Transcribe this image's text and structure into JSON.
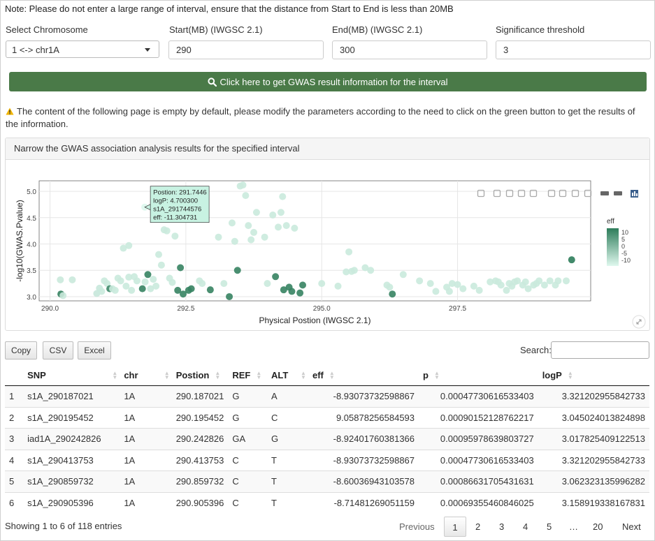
{
  "note": "Note: Please do not enter a large range of interval, ensure that the distance from Start to End is less than 20MB",
  "form": {
    "chromosome_label": "Select Chromosome",
    "chromosome_value": "1 <-> chr1A",
    "start_label": "Start(MB) (IWGSC 2.1)",
    "start_value": "290",
    "end_label": "End(MB) (IWGSC 2.1)",
    "end_value": "300",
    "threshold_label": "Significance threshold",
    "threshold_value": "3"
  },
  "button_label": "Click here to get GWAS result information for the interval",
  "warning": "The content of the following page is empty by default, please modify the parameters according to the need to click on the green button to get the results of the information.",
  "panel_title": "Narrow the GWAS association analysis results for the specified interval",
  "colors": {
    "accent": "#4a7a48",
    "low": "#dff8ee",
    "high": "#2e7d5b"
  },
  "chart_data": {
    "type": "scatter",
    "xlabel": "Physical Postion (IWGSC 2.1)",
    "ylabel": "-log10(GWAS.Pvalue)",
    "xlim": [
      289.8,
      299.95
    ],
    "ylim": [
      2.92,
      5.2
    ],
    "xticks": [
      290.0,
      292.5,
      295.0,
      297.5
    ],
    "xtick_labels": [
      "290.0",
      "292.5",
      "295.0",
      "297.5"
    ],
    "yticks": [
      3.0,
      3.5,
      4.0,
      4.5,
      5.0
    ],
    "ytick_labels": [
      "3.0",
      "3.5",
      "4.0",
      "4.5",
      "5.0"
    ],
    "colorbar": {
      "title": "eff",
      "ticks": [
        "10",
        "5",
        "0",
        "-5",
        "-10"
      ]
    },
    "tooltip": [
      "Postion: 291.7446",
      "logP: 4.700300",
      "s1A_291744576",
      "eff: -11.304731"
    ],
    "points": [
      [
        290.19,
        3.32,
        -8.9
      ],
      [
        290.2,
        3.05,
        9.1
      ],
      [
        290.24,
        3.02,
        -8.9
      ],
      [
        290.41,
        3.32,
        -8.9
      ],
      [
        290.86,
        3.06,
        -8.6
      ],
      [
        290.91,
        3.16,
        -8.7
      ],
      [
        290.95,
        3.1,
        -9
      ],
      [
        291.0,
        3.3,
        -9
      ],
      [
        291.05,
        3.25,
        -9
      ],
      [
        291.1,
        3.15,
        8
      ],
      [
        291.15,
        3.15,
        -9
      ],
      [
        291.2,
        3.12,
        -9
      ],
      [
        291.25,
        3.35,
        -9
      ],
      [
        291.3,
        3.3,
        -9
      ],
      [
        291.35,
        3.92,
        -9
      ],
      [
        291.45,
        3.97,
        -9
      ],
      [
        291.4,
        3.2,
        -9
      ],
      [
        291.45,
        3.37,
        -9
      ],
      [
        291.5,
        3.12,
        -9
      ],
      [
        291.55,
        3.38,
        -9
      ],
      [
        291.6,
        3.3,
        -9
      ],
      [
        291.7,
        3.15,
        9
      ],
      [
        291.75,
        3.28,
        -9
      ],
      [
        291.8,
        3.42,
        9
      ],
      [
        291.85,
        3.15,
        -9
      ],
      [
        291.9,
        3.33,
        -9
      ],
      [
        291.95,
        3.2,
        -9
      ],
      [
        292.0,
        3.8,
        -9
      ],
      [
        292.05,
        3.6,
        -9
      ],
      [
        292.1,
        4.27,
        -9
      ],
      [
        292.15,
        4.25,
        -9
      ],
      [
        292.2,
        3.35,
        -9
      ],
      [
        292.25,
        3.27,
        -9
      ],
      [
        292.3,
        4.15,
        -9
      ],
      [
        292.35,
        3.12,
        9
      ],
      [
        292.4,
        3.55,
        9
      ],
      [
        292.45,
        3.05,
        9
      ],
      [
        292.55,
        3.12,
        9
      ],
      [
        292.6,
        3.15,
        9
      ],
      [
        292.75,
        3.3,
        -9
      ],
      [
        292.8,
        3.25,
        -9
      ],
      [
        292.95,
        3.13,
        9
      ],
      [
        293.1,
        4.13,
        -9
      ],
      [
        293.2,
        3.25,
        -9
      ],
      [
        293.3,
        3.0,
        9
      ],
      [
        293.35,
        4.4,
        -9
      ],
      [
        293.4,
        4.05,
        -9
      ],
      [
        293.45,
        3.5,
        9
      ],
      [
        293.5,
        5.1,
        -9
      ],
      [
        293.55,
        5.12,
        -9
      ],
      [
        293.6,
        4.92,
        -9
      ],
      [
        293.65,
        4.35,
        -9
      ],
      [
        293.7,
        4.08,
        -9
      ],
      [
        293.75,
        4.22,
        -9
      ],
      [
        293.8,
        4.6,
        -9
      ],
      [
        293.95,
        4.13,
        -9
      ],
      [
        294.0,
        3.25,
        -9
      ],
      [
        294.1,
        4.55,
        -9
      ],
      [
        294.15,
        3.38,
        9
      ],
      [
        294.2,
        4.32,
        -9
      ],
      [
        294.25,
        4.6,
        -9
      ],
      [
        294.28,
        4.9,
        -9
      ],
      [
        294.3,
        3.13,
        9
      ],
      [
        294.35,
        4.35,
        -9
      ],
      [
        294.4,
        3.18,
        9
      ],
      [
        294.45,
        3.1,
        9
      ],
      [
        294.5,
        4.3,
        -9
      ],
      [
        294.6,
        3.07,
        9
      ],
      [
        294.65,
        3.22,
        9
      ],
      [
        295.0,
        3.25,
        -9
      ],
      [
        295.3,
        3.2,
        -9
      ],
      [
        295.45,
        3.47,
        -9
      ],
      [
        295.5,
        3.85,
        -9
      ],
      [
        295.55,
        3.48,
        -9
      ],
      [
        295.6,
        3.5,
        -9
      ],
      [
        295.8,
        3.55,
        -9
      ],
      [
        295.9,
        3.5,
        -9
      ],
      [
        296.2,
        3.22,
        -9
      ],
      [
        296.25,
        3.18,
        -9
      ],
      [
        296.3,
        3.05,
        9
      ],
      [
        296.5,
        3.42,
        -9
      ],
      [
        296.8,
        3.3,
        -9
      ],
      [
        297.0,
        3.25,
        -9
      ],
      [
        297.1,
        3.1,
        -9
      ],
      [
        297.3,
        3.18,
        -9
      ],
      [
        297.35,
        3.1,
        -9
      ],
      [
        297.4,
        3.25,
        -9
      ],
      [
        297.5,
        3.23,
        -9
      ],
      [
        297.6,
        3.15,
        -9
      ],
      [
        297.8,
        3.2,
        -9
      ],
      [
        297.9,
        3.12,
        -9
      ],
      [
        298.1,
        3.28,
        -9
      ],
      [
        298.2,
        3.3,
        -9
      ],
      [
        298.25,
        3.28,
        -9
      ],
      [
        298.3,
        3.22,
        -9
      ],
      [
        298.4,
        3.12,
        -9
      ],
      [
        298.45,
        3.25,
        -9
      ],
      [
        298.5,
        3.2,
        -9
      ],
      [
        298.55,
        3.28,
        -9
      ],
      [
        298.6,
        3.3,
        -9
      ],
      [
        298.7,
        3.22,
        -9
      ],
      [
        298.75,
        3.28,
        -9
      ],
      [
        298.8,
        3.15,
        -9
      ],
      [
        298.9,
        3.22,
        -9
      ],
      [
        298.95,
        3.25,
        -9
      ],
      [
        299.0,
        3.3,
        -9
      ],
      [
        299.1,
        3.22,
        -9
      ],
      [
        299.2,
        3.3,
        -9
      ],
      [
        299.3,
        3.22,
        -9
      ],
      [
        299.35,
        3.3,
        -9
      ],
      [
        299.5,
        3.3,
        -9
      ],
      [
        299.6,
        3.7,
        10
      ],
      [
        291.744,
        4.7,
        -11.3
      ]
    ]
  },
  "table_buttons": [
    "Copy",
    "CSV",
    "Excel"
  ],
  "search_label": "Search:",
  "table": {
    "headers": [
      "",
      "SNP",
      "chr",
      "Postion",
      "REF",
      "ALT",
      "eff",
      "p",
      "logP"
    ],
    "rows": [
      [
        "1",
        "s1A_290187021",
        "1A",
        "290.187021",
        "G",
        "A",
        "-8.93073732598867",
        "0.00047730616533403",
        "3.321202955842733"
      ],
      [
        "2",
        "s1A_290195452",
        "1A",
        "290.195452",
        "G",
        "C",
        "9.05878256584593",
        "0.00090152128762217",
        "3.045024013824898"
      ],
      [
        "3",
        "iad1A_290242826",
        "1A",
        "290.242826",
        "GA",
        "G",
        "-8.92401760381366",
        "0.00095978639803727",
        "3.017825409122513"
      ],
      [
        "4",
        "s1A_290413753",
        "1A",
        "290.413753",
        "C",
        "T",
        "-8.93073732598867",
        "0.00047730616533403",
        "3.321202955842733"
      ],
      [
        "5",
        "s1A_290859732",
        "1A",
        "290.859732",
        "C",
        "T",
        "-8.60036943103578",
        "0.00086631705431631",
        "3.062323135996282"
      ],
      [
        "6",
        "s1A_290905396",
        "1A",
        "290.905396",
        "C",
        "T",
        "-8.71481269051159",
        "0.00069355460846025",
        "3.158919338167831"
      ]
    ]
  },
  "info": "Showing 1 to 6 of 118 entries",
  "pagination": {
    "previous": "Previous",
    "pages": [
      "1",
      "2",
      "3",
      "4",
      "5",
      "…",
      "20"
    ],
    "next": "Next"
  }
}
